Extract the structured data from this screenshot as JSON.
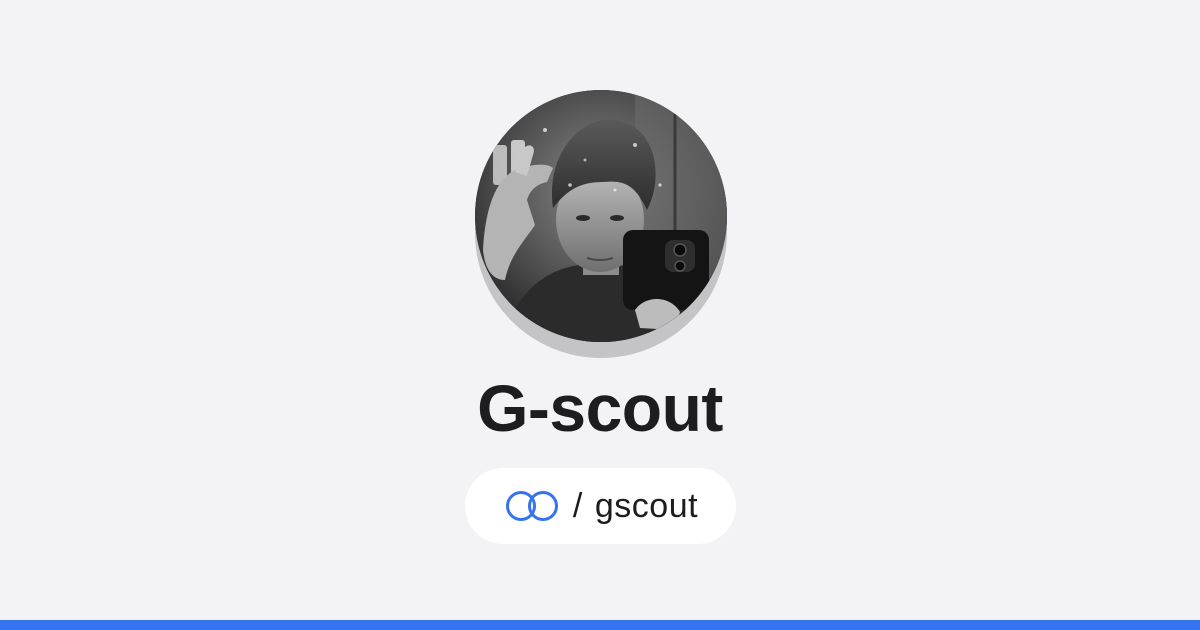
{
  "profile": {
    "name": "G-scout",
    "handle_separator": "/",
    "handle": "gscout",
    "avatar_icon": "profile-photo",
    "brand_icon": "linked-rings-logo-icon"
  },
  "colors": {
    "background": "#f3f3f5",
    "accent": "#3673f0",
    "pill": "#ffffff",
    "text": "#1d1d1f"
  }
}
